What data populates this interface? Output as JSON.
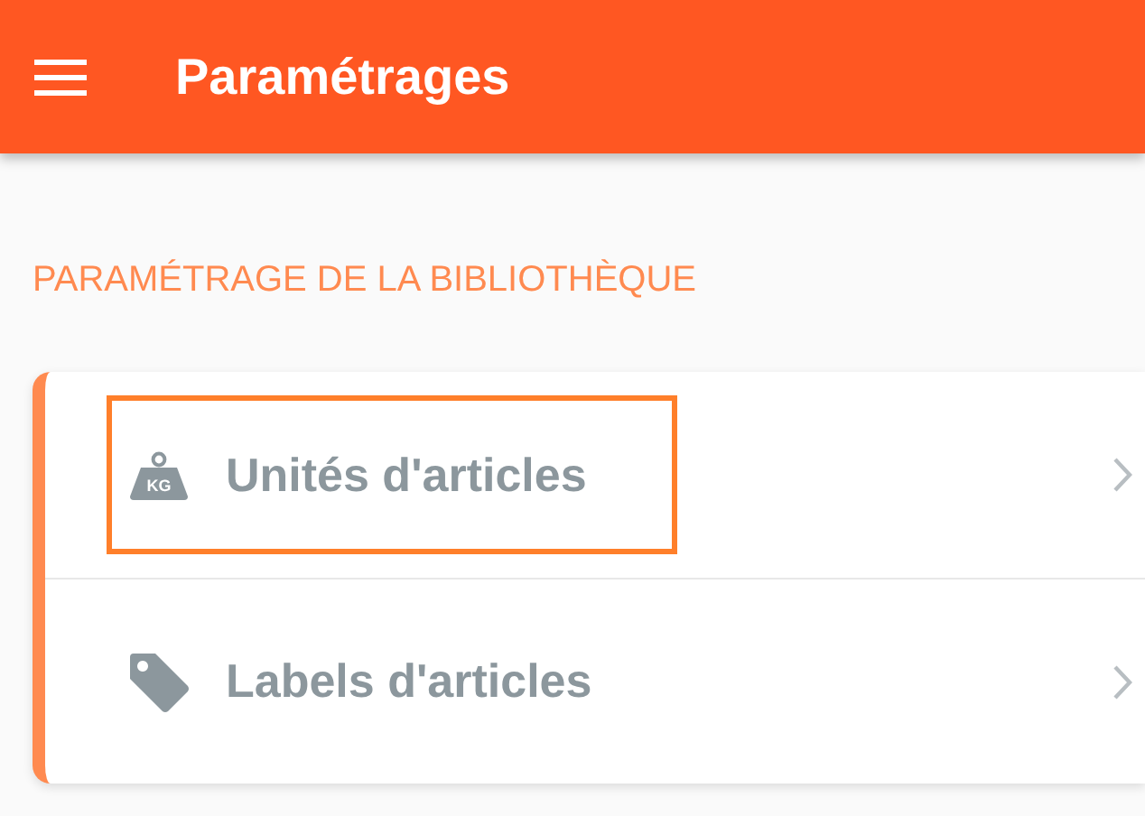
{
  "app_bar": {
    "title": "Paramétrages"
  },
  "section": {
    "title": "PARAMÉTRAGE DE LA BIBLIOTHÈQUE"
  },
  "items": [
    {
      "kind": "weight",
      "label": "Unités d'articles",
      "icon_text": "KG",
      "highlighted": true
    },
    {
      "kind": "tag",
      "label": "Labels d'articles",
      "highlighted": false
    }
  ]
}
